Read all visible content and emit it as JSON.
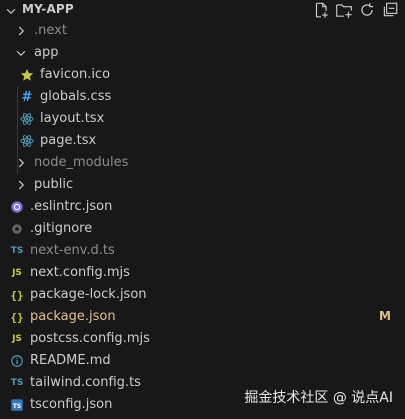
{
  "explorer": {
    "title": "MY-APP",
    "actions": [
      "new-file-icon",
      "new-folder-icon",
      "refresh-icon",
      "collapse-all-icon"
    ]
  },
  "tree": [
    {
      "label": "next",
      "prefix": ".",
      "icon": "chevron-right-icon",
      "kind": "folder",
      "depth": 0,
      "dim": true
    },
    {
      "label": "app",
      "icon": "chevron-down-icon",
      "kind": "folder",
      "depth": 0
    },
    {
      "label": "favicon.ico",
      "icon": "star-icon",
      "kind": "file",
      "depth": 1
    },
    {
      "label": "globals.css",
      "icon": "hash-icon",
      "kind": "file",
      "depth": 1
    },
    {
      "label": "layout.tsx",
      "icon": "react-icon",
      "kind": "file",
      "depth": 1
    },
    {
      "label": "page.tsx",
      "icon": "react-icon",
      "kind": "file",
      "depth": 1
    },
    {
      "label": "node_modules",
      "icon": "chevron-right-icon",
      "kind": "folder",
      "depth": 0,
      "dim": true
    },
    {
      "label": "public",
      "icon": "chevron-right-icon",
      "kind": "folder",
      "depth": 0
    },
    {
      "label": ".eslintrc.json",
      "icon": "eslint-icon",
      "kind": "file",
      "depth": 0
    },
    {
      "label": ".gitignore",
      "icon": "git-icon",
      "kind": "file",
      "depth": 0
    },
    {
      "label": "next-env.d.ts",
      "icon": "ts-icon",
      "kind": "file",
      "depth": 0,
      "dim": true
    },
    {
      "label": "next.config.mjs",
      "icon": "js-icon",
      "kind": "file",
      "depth": 0
    },
    {
      "label": "package-lock.json",
      "icon": "json-icon",
      "kind": "file",
      "depth": 0
    },
    {
      "label": "package.json",
      "icon": "json-icon",
      "kind": "file",
      "depth": 0,
      "modified": true,
      "badge": "M"
    },
    {
      "label": "postcss.config.mjs",
      "icon": "js-icon",
      "kind": "file",
      "depth": 0
    },
    {
      "label": "README.md",
      "icon": "info-icon",
      "kind": "file",
      "depth": 0
    },
    {
      "label": "tailwind.config.ts",
      "icon": "ts-icon",
      "kind": "file",
      "depth": 0
    },
    {
      "label": "tsconfig.json",
      "icon": "tsconfig-icon",
      "kind": "file",
      "depth": 0
    }
  ],
  "colors": {
    "background": "#181818",
    "text": "#cccccc",
    "dimmed": "#8c8c8c",
    "modified": "#e2c08d",
    "ts": "#519aba",
    "js": "#cbcb41",
    "react": "#519aba",
    "css": "#42a5f5",
    "star": "#cbcb41"
  },
  "watermark": "掘金技术社区 @ 说点AI"
}
